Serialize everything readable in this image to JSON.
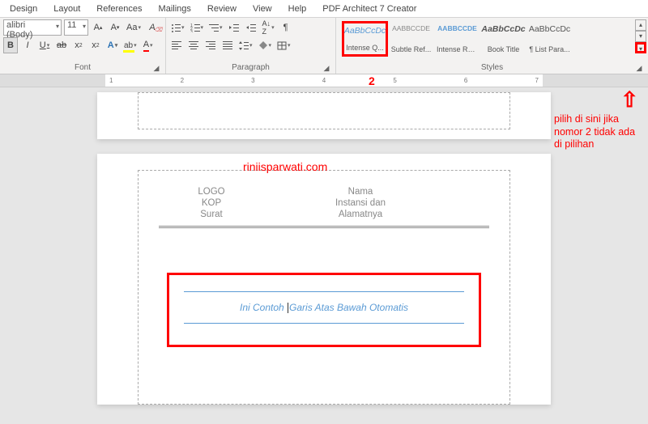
{
  "tabs": [
    "Design",
    "Layout",
    "References",
    "Mailings",
    "Review",
    "View",
    "Help",
    "PDF Architect 7 Creator"
  ],
  "font": {
    "name": "alibri (Body)",
    "size": "11",
    "group_label": "Font"
  },
  "paragraph": {
    "group_label": "Paragraph"
  },
  "styles": {
    "group_label": "Styles",
    "items": [
      {
        "preview": "AaBbCcDc",
        "name": "Intense Q...",
        "color": "#5b9bd5",
        "italic": true,
        "highlight": true
      },
      {
        "preview": "AABBCCDE",
        "name": "Subtle Ref...",
        "color": "#888",
        "italic": false
      },
      {
        "preview": "AABBCCDE",
        "name": "Intense Re...",
        "color": "#5b9bd5",
        "italic": false
      },
      {
        "preview": "AaBbCcDc",
        "name": "Book Title",
        "color": "#222",
        "italic": true,
        "bold": true
      },
      {
        "preview": "AaBbCcDc",
        "name": "¶ List Para...",
        "color": "#444",
        "italic": false
      }
    ]
  },
  "ruler_numbers": [
    "1",
    "2",
    "3",
    "4",
    "5",
    "6",
    "7"
  ],
  "document": {
    "kop_left": [
      "LOGO",
      "KOP",
      "Surat"
    ],
    "kop_right": [
      "Nama",
      "Instansi dan",
      "Alamatnya"
    ],
    "quote_before": "Ini Contoh ",
    "quote_after": "Garis Atas Bawah Otomatis"
  },
  "annotations": {
    "num": "2",
    "note": "pilih di sini jika nomor 2 tidak ada di pilihan",
    "watermark": "riniisparwati.com"
  }
}
